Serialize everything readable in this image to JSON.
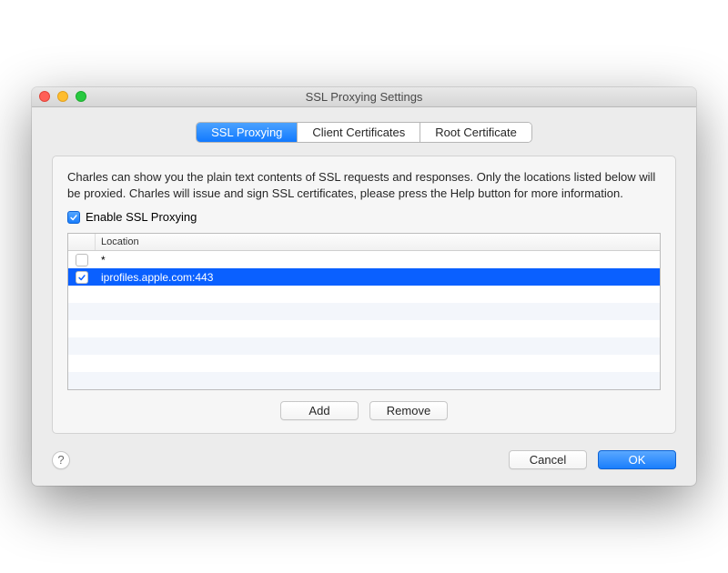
{
  "window": {
    "title": "SSL Proxying Settings"
  },
  "tabs": [
    {
      "label": "SSL Proxying",
      "active": true
    },
    {
      "label": "Client Certificates",
      "active": false
    },
    {
      "label": "Root Certificate",
      "active": false
    }
  ],
  "description": "Charles can show you the plain text contents of SSL requests and responses. Only the locations listed below will be proxied. Charles will issue and sign SSL certificates, please press the Help button for more information.",
  "enable": {
    "label": "Enable SSL Proxying",
    "checked": true
  },
  "table": {
    "header": "Location",
    "rows": [
      {
        "checked": false,
        "location": "*",
        "selected": false
      },
      {
        "checked": true,
        "location": "iprofiles.apple.com:443",
        "selected": true
      }
    ]
  },
  "buttons": {
    "add": "Add",
    "remove": "Remove",
    "cancel": "Cancel",
    "ok": "OK"
  },
  "help_glyph": "?"
}
